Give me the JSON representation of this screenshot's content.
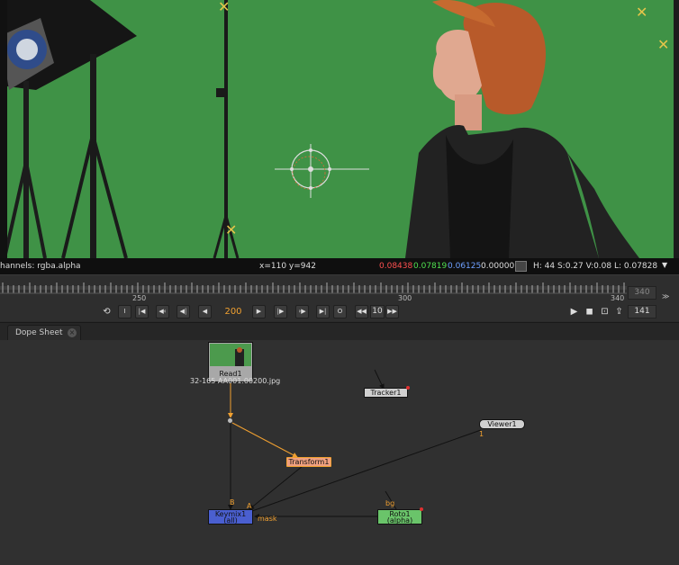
{
  "infobar": {
    "channels": "hannels: rgba.alpha",
    "coords": "x=110 y=942",
    "r": "0.08438",
    "g": "0.07819",
    "b": "0.06125",
    "a": "0.00000",
    "hsvl": "H: 44 S:0.27 V:0.08  L: 0.07828",
    "colors": {
      "r": "#ff5050",
      "g": "#50e050",
      "b": "#6ea0ff"
    }
  },
  "timeline": {
    "ticks": [
      "250",
      "300",
      "340"
    ],
    "current_frame": "200",
    "increment": "10",
    "end_frame": "340",
    "global_frame": "141"
  },
  "tabs": [
    {
      "label": "Dope Sheet"
    }
  ],
  "nodes": {
    "read": {
      "label": "Read1",
      "sub": "32-165  AA001.00200.jpg"
    },
    "tracker": {
      "label": "Tracker1"
    },
    "viewer": {
      "label": "Viewer1",
      "input": "1"
    },
    "transform": {
      "label": "Transform1"
    },
    "keymix": {
      "label": "Keymix1",
      "sub": "(all)",
      "b": "B",
      "a": "A",
      "mask": "mask"
    },
    "roto": {
      "label": "Roto1",
      "sub": "(alpha)",
      "bg": "bg"
    }
  },
  "colors": {
    "green_screen": "#3f9246",
    "node_read": "#a8a8a8",
    "node_transform": "#f0a080",
    "node_keymix": "#4a5fd0",
    "node_roto": "#6ac46a",
    "node_gray": "#d0d0d0",
    "accent": "#f0a030"
  }
}
